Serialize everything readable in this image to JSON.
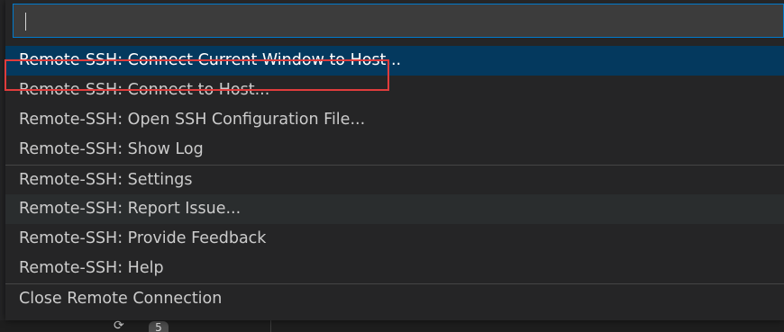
{
  "command_palette": {
    "input_value": "",
    "input_placeholder": "",
    "items": [
      {
        "label": "Remote-SSH: Connect Current Window to Host...",
        "state": "selected"
      },
      {
        "label": "Remote-SSH: Connect to Host..."
      },
      {
        "label": "Remote-SSH: Open SSH Configuration File...",
        "annotated": true
      },
      {
        "label": "Remote-SSH: Show Log"
      },
      {
        "label": "Remote-SSH: Settings"
      },
      {
        "label": "Remote-SSH: Report Issue...",
        "state": "hover"
      },
      {
        "label": "Remote-SSH: Provide Feedback"
      },
      {
        "label": "Remote-SSH: Help"
      },
      {
        "label": "Close Remote Connection"
      }
    ]
  },
  "background": {
    "sync_icon": "sync-icon",
    "badge_count": "5"
  },
  "colors": {
    "selected_bg": "#04395e",
    "hover_bg": "#2a2d2e",
    "input_border": "#007acc",
    "annotation_border": "#e03c3c"
  }
}
